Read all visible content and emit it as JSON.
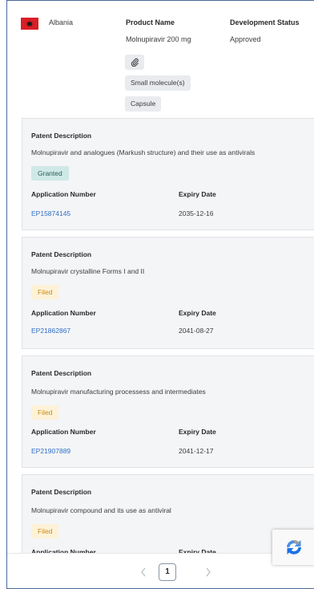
{
  "country": {
    "name": "Albania"
  },
  "product": {
    "name_header": "Product Name",
    "name_value": "Molnupiravir 200 mg",
    "status_header": "Development Status",
    "status_value": "Approved",
    "attributes": [
      "Small molecule(s)",
      "Capsule"
    ]
  },
  "labels": {
    "patent_description": "Patent Description",
    "application_number": "Application Number",
    "expiry_date": "Expiry Date"
  },
  "patents": [
    {
      "description": "Molnupiravir and analogues (Markush structure) and their use as antivirals",
      "status": "Granted",
      "application_number": "EP15874145",
      "expiry_date": "2035-12-16"
    },
    {
      "description": "Molnupiravir crystalline Forms I and II",
      "status": "Filed",
      "application_number": "EP21862867",
      "expiry_date": "2041-08-27"
    },
    {
      "description": "Molnupiravir manufacturing processess and intermediates",
      "status": "Filed",
      "application_number": "EP21907889",
      "expiry_date": "2041-12-17"
    },
    {
      "description": "Molnupiravir compound and its use as antiviral",
      "status": "Filed",
      "application_number": "",
      "expiry_date": ""
    }
  ],
  "pagination": {
    "current_page": "1"
  },
  "colors": {
    "granted_bg": "#cfe9e6",
    "filed_bg": "#fdf2d8",
    "link": "#2f6fc4",
    "flag_red": "#d91f26"
  },
  "icons": {
    "attachment": "paperclip-icon",
    "flag": "albania-flag-icon",
    "prev": "chevron-left-icon",
    "next": "chevron-right-icon"
  }
}
